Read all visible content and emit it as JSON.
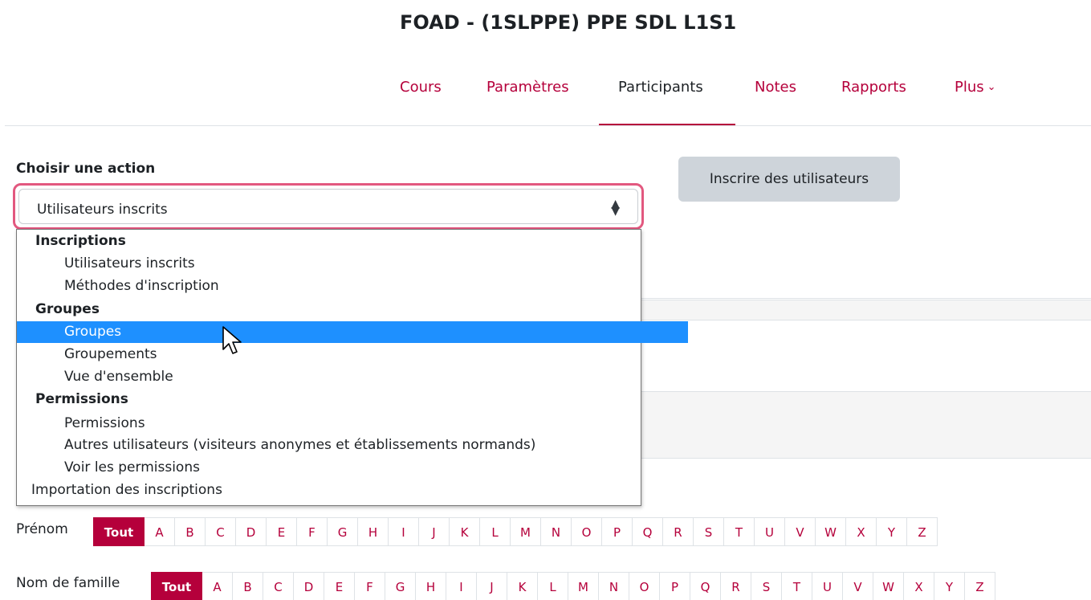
{
  "course": {
    "title": "FOAD - (1SLPPE) PPE SDL L1S1"
  },
  "nav": {
    "items": [
      {
        "label": "Cours",
        "active": false
      },
      {
        "label": "Paramètres",
        "active": false
      },
      {
        "label": "Participants",
        "active": true
      },
      {
        "label": "Notes",
        "active": false
      },
      {
        "label": "Rapports",
        "active": false
      },
      {
        "label": "Plus",
        "active": false
      }
    ],
    "more_icon": "chevron-down-icon"
  },
  "action": {
    "label": "Choisir une action",
    "selected": "Utilisateurs inscrits",
    "select_icon": "sort-arrows-icon"
  },
  "enrol_button": {
    "label": "Inscrire des utilisateurs"
  },
  "dropdown": {
    "options": [
      {
        "type": "group",
        "label": "Inscriptions"
      },
      {
        "type": "item",
        "label": "Utilisateurs inscrits"
      },
      {
        "type": "item",
        "label": "Méthodes d'inscription"
      },
      {
        "type": "group",
        "label": "Groupes"
      },
      {
        "type": "item",
        "label": "Groupes",
        "highlighted": true
      },
      {
        "type": "item",
        "label": "Groupements"
      },
      {
        "type": "item",
        "label": "Vue d'ensemble"
      },
      {
        "type": "group",
        "label": "Permissions"
      },
      {
        "type": "item",
        "label": "Permissions"
      },
      {
        "type": "item",
        "label": "Autres utilisateurs (visiteurs anonymes et établissements normands)"
      },
      {
        "type": "item",
        "label": "Voir les permissions"
      },
      {
        "type": "top",
        "label": "Importation des inscriptions"
      }
    ]
  },
  "filters": {
    "firstname": {
      "label": "Prénom",
      "all": "Tout"
    },
    "lastname": {
      "label": "Nom de famille",
      "all": "Tout"
    },
    "letters": [
      "A",
      "B",
      "C",
      "D",
      "E",
      "F",
      "G",
      "H",
      "I",
      "J",
      "K",
      "L",
      "M",
      "N",
      "O",
      "P",
      "Q",
      "R",
      "S",
      "T",
      "U",
      "V",
      "W",
      "X",
      "Y",
      "Z"
    ]
  },
  "colors": {
    "accent": "#b5003b",
    "focus_ring": "#e2587f",
    "highlight": "#1e90ff",
    "button_bg": "#ced4da"
  }
}
